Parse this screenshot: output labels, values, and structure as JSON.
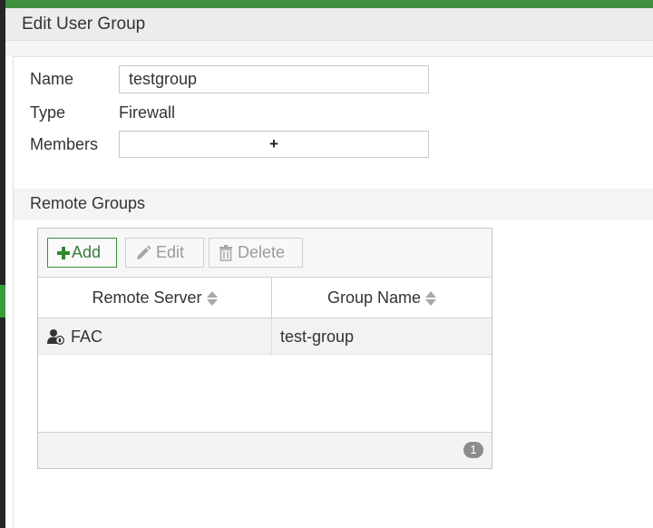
{
  "dialog": {
    "title": "Edit User Group"
  },
  "form": {
    "name_label": "Name",
    "name_value": "testgroup",
    "type_label": "Type",
    "type_value": "Firewall",
    "members_label": "Members",
    "members_add_symbol": "+"
  },
  "remote_groups": {
    "section_title": "Remote Groups",
    "toolbar": {
      "add_label": "Add",
      "edit_label": "Edit",
      "delete_label": "Delete"
    },
    "columns": [
      "Remote Server",
      "Group Name"
    ],
    "rows": [
      {
        "remote_server": "FAC",
        "group_name": "test-group",
        "icon": "remote-user-icon"
      }
    ],
    "row_count": "1"
  },
  "colors": {
    "accent_green": "#3f8f3f",
    "header_gray": "#ececec"
  }
}
